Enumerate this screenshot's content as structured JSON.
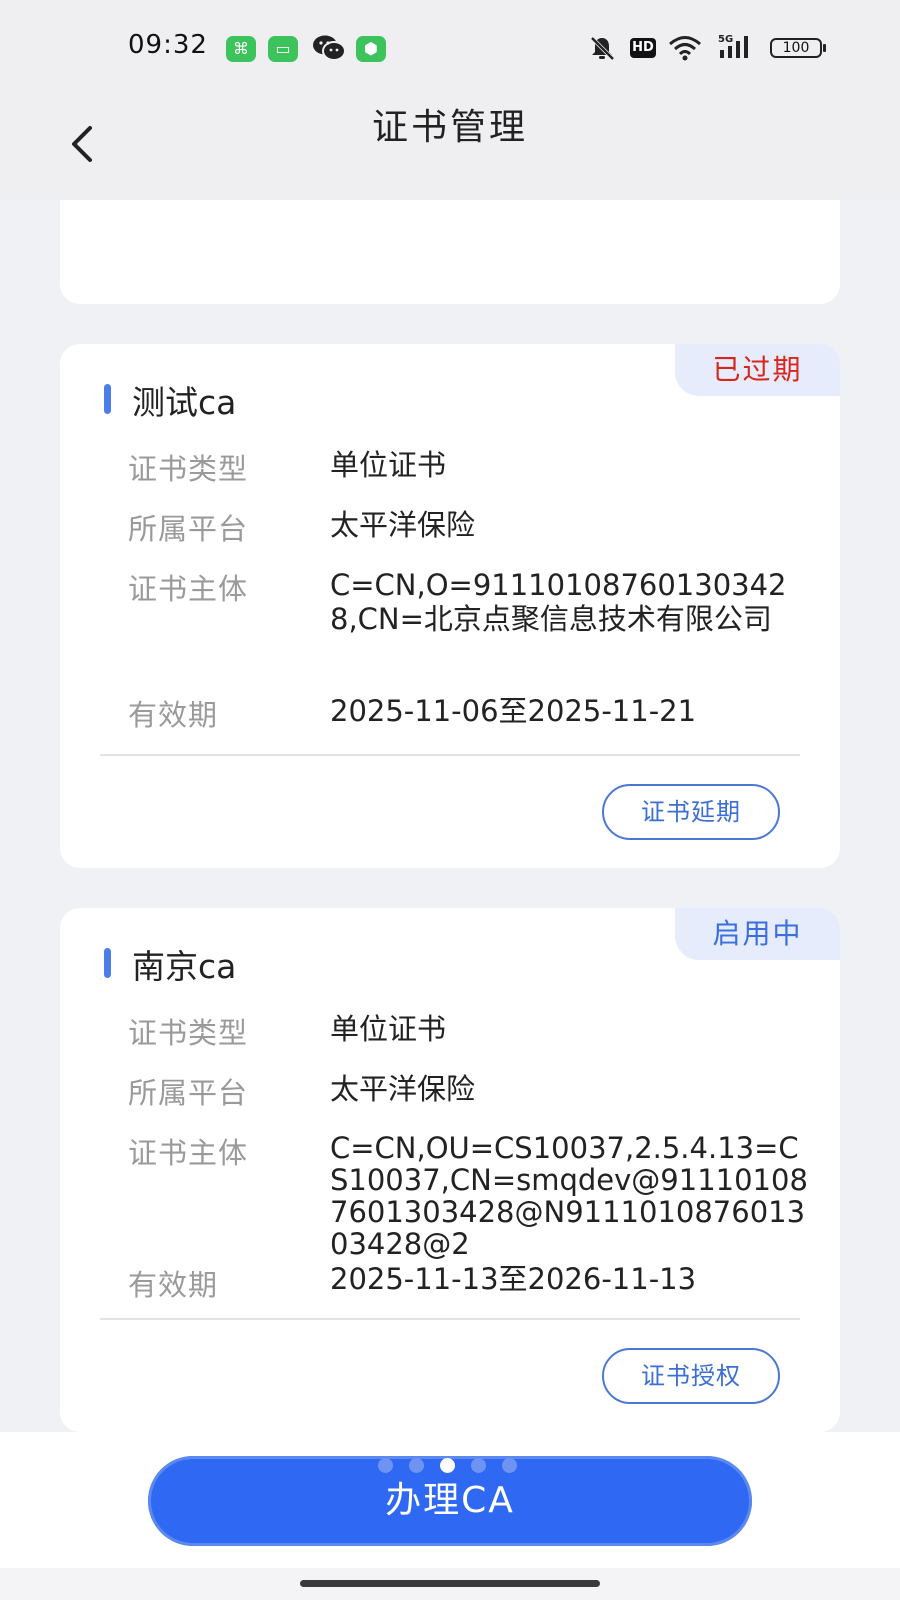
{
  "status_bar": {
    "time": "09:32",
    "battery": "100",
    "hd": "HD",
    "network": "5G"
  },
  "nav": {
    "title": "证书管理"
  },
  "cards": [
    {
      "status": "已过期",
      "title": "测试ca",
      "rows": [
        {
          "label": "证书类型",
          "value": "单位证书"
        },
        {
          "label": "所属平台",
          "value": "太平洋保险"
        },
        {
          "label": "证书主体",
          "value": "C=CN,O=911101087601303428,CN=北京点聚信息技术有限公司"
        },
        {
          "label": "有效期",
          "value": "2025-11-06至2025-11-21"
        }
      ],
      "action": "证书延期"
    },
    {
      "status": "启用中",
      "title": "南京ca",
      "rows": [
        {
          "label": "证书类型",
          "value": "单位证书"
        },
        {
          "label": "所属平台",
          "value": "太平洋保险"
        },
        {
          "label": "证书主体",
          "value": "C=CN,OU=CS10037,2.5.4.13=CS10037,CN=smqdev@911101087601303428@N911101087601303428@2"
        },
        {
          "label": "有效期",
          "value": "2025-11-13至2026-11-13"
        }
      ],
      "action": "证书授权"
    }
  ],
  "bottom": {
    "primary_label": "办理CA",
    "pager_count": 5,
    "pager_active": 3
  },
  "colors": {
    "accent": "#2f68f2",
    "expired": "#d9261c",
    "active": "#3b6fe0"
  }
}
